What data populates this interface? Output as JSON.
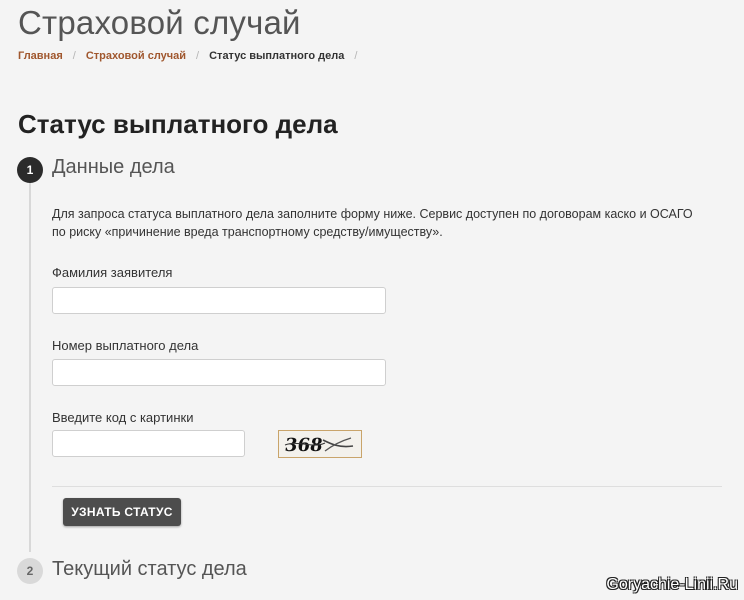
{
  "page": {
    "title": "Страховой случай"
  },
  "breadcrumb": {
    "items": [
      "Главная",
      "Страховой случай",
      "Статус выплатного дела"
    ],
    "separator": "/"
  },
  "section": {
    "title": "Статус выплатного дела"
  },
  "steps": [
    {
      "number": "1",
      "title": "Данные дела",
      "state": "active"
    },
    {
      "number": "2",
      "title": "Текущий статус дела",
      "state": "inactive"
    }
  ],
  "form": {
    "description": "Для запроса статуса выплатного дела заполните форму ниже. Сервис доступен по договорам каско и ОСАГО по риску «причинение вреда транспортному средству/имуществу».",
    "fields": [
      {
        "label": "Фамилия заявителя",
        "value": ""
      },
      {
        "label": "Номер выплатного дела",
        "value": ""
      },
      {
        "label": "Введите код с картинки",
        "value": ""
      }
    ],
    "captcha_text": "368",
    "submit_label": "УЗНАТЬ СТАТУС"
  },
  "watermark": "Goryachie-Linii.Ru",
  "colors": {
    "link": "#a0572e",
    "button": "#4d4d4d",
    "step_active": "#2b2b2b",
    "step_inactive": "#d9d9d9"
  },
  "icons": {
    "captcha": "captcha-image"
  }
}
